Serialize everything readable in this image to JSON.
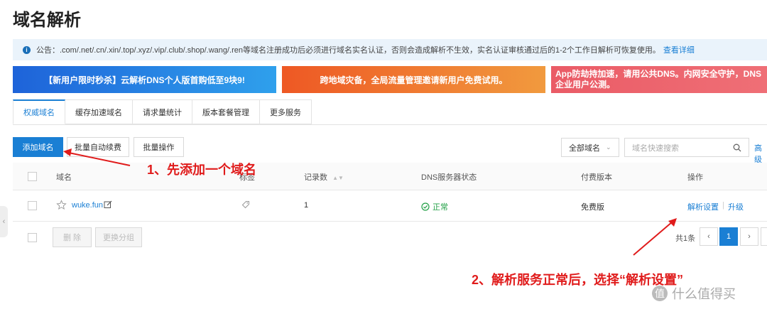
{
  "page_title": "域名解析",
  "notice": {
    "text": "公告：.com/.net/.cn/.xin/.top/.xyz/.vip/.club/.shop/.wang/.ren等域名注册成功后必须进行域名实名认证，否则会造成解析不生效，实名认证审核通过后的1-2个工作日解析可恢复使用。",
    "link": "查看详细"
  },
  "banners": [
    "【新用户限时秒杀】云解析DNS个人版首购低至9块9!",
    "跨地域灾备，全局流量管理邀请新用户免费试用。",
    "App防劫持加速，请用公共DNS。内网安全守护，DNS",
    "企业用户公测。"
  ],
  "tabs": [
    "权威域名",
    "缓存加速域名",
    "请求量统计",
    "版本套餐管理",
    "更多服务"
  ],
  "toolbar": {
    "add_domain": "添加域名",
    "batch_renew": "批量自动续费",
    "batch_ops": "批量操作",
    "filter_select": "全部域名",
    "search_placeholder": "域名快速搜索",
    "advanced": "高级"
  },
  "table": {
    "headers": {
      "domain": "域名",
      "tag": "标签",
      "records": "记录数",
      "dns_status": "DNS服务器状态",
      "edition": "付费版本",
      "actions": "操作"
    },
    "rows": [
      {
        "domain": "wuke.fun",
        "records": "1",
        "dns_status": "正常",
        "edition": "免费版",
        "action_1": "解析设置",
        "action_2": "升级"
      }
    ]
  },
  "footer": {
    "delete": "删 除",
    "change_group": "更换分组",
    "total": "共1条",
    "current_page": "1"
  },
  "annotations": {
    "step1": "1、先添加一个域名",
    "step2": "2、解析服务正常后，选择“解析设置”"
  },
  "watermark": "什么值得买",
  "colors": {
    "accent": "#1a7fd4",
    "annotation": "#e01b1b",
    "status_ok": "#23a047"
  }
}
